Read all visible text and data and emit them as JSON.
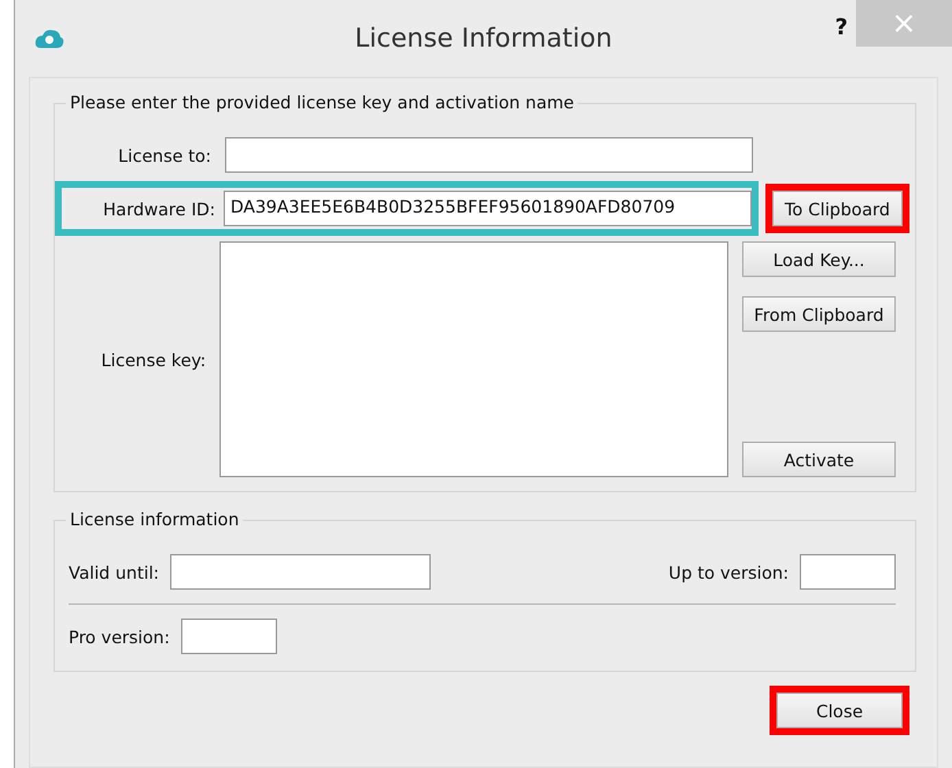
{
  "window": {
    "title": "License Information",
    "help": "?",
    "close": "×"
  },
  "activation": {
    "legend": "Please enter the provided license key and activation name",
    "license_to": {
      "label": "License to:"
    },
    "hardware_id": {
      "label": "Hardware ID:",
      "value": "DA39A3EE5E6B4B0D3255BFEF95601890AFD80709",
      "color": "#3bbdc0"
    },
    "to_clipboard": {
      "label": "To Clipboard",
      "color": "#ff0000"
    },
    "license_key": {
      "label": "License key:"
    },
    "buttons": [
      {
        "label": "Load Key..."
      },
      {
        "label": "From Clipboard"
      },
      {
        "label": "Activate"
      }
    ]
  },
  "license_information": {
    "legend": "License information",
    "valid_until": {
      "label": "Valid until:"
    },
    "up_to_version": {
      "label": "Up to version:"
    },
    "pro_version": {
      "label": "Pro version:"
    }
  },
  "close_button": {
    "label": "Close",
    "color": "#ff0000"
  }
}
